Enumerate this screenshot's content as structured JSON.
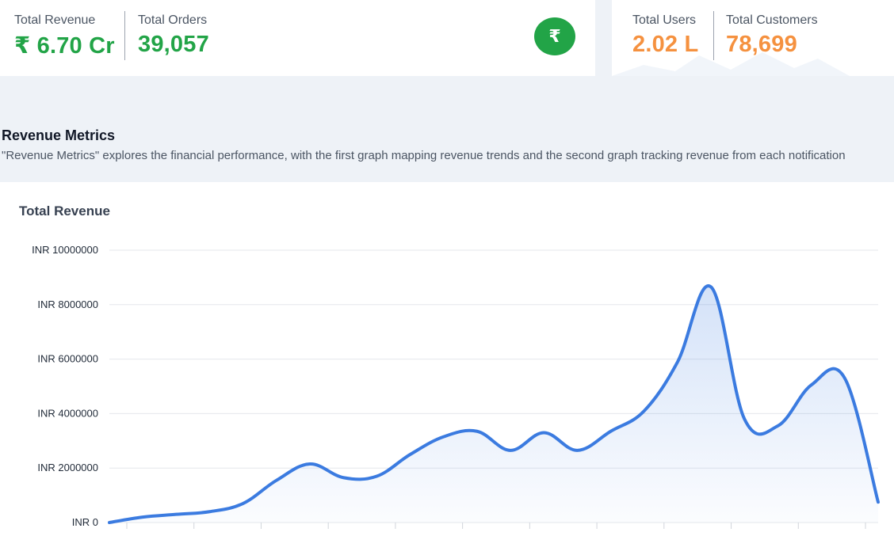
{
  "stats_left": {
    "total_revenue": {
      "label": "Total Revenue",
      "value": "₹ 6.70 Cr"
    },
    "total_orders": {
      "label": "Total Orders",
      "value": "39,057"
    },
    "badge_icon": "rupee-icon",
    "badge_glyph": "₹"
  },
  "stats_right": {
    "total_users": {
      "label": "Total Users",
      "value": "2.02 L"
    },
    "total_customers": {
      "label": "Total Customers",
      "value": "78,699"
    }
  },
  "section": {
    "title": "Revenue Metrics",
    "description": "\"Revenue Metrics\" explores the financial performance, with the first graph mapping revenue trends and the second graph tracking revenue from each notification"
  },
  "colors": {
    "green": "#22a447",
    "orange": "#f5913f",
    "line": "#3b7be0"
  },
  "chart_data": {
    "type": "area",
    "title": "Total Revenue",
    "ylabel": "",
    "xlabel": "",
    "ylim": [
      0,
      10000000
    ],
    "yticks": [
      "INR 0",
      "INR 2000000",
      "INR 4000000",
      "INR 6000000",
      "INR 8000000",
      "INR 10000000"
    ],
    "ytick_values": [
      0,
      2000000,
      4000000,
      6000000,
      8000000,
      10000000
    ],
    "grid": true,
    "series": [
      {
        "values": [
          0,
          200000,
          300000,
          400000,
          700000,
          1550000,
          2150000,
          1650000,
          1700000,
          2500000,
          3150000,
          3350000,
          2650000,
          3300000,
          2650000,
          3350000,
          4100000,
          5900000,
          8650000,
          3800000,
          3550000,
          5050000,
          5300000,
          750000
        ]
      }
    ]
  }
}
